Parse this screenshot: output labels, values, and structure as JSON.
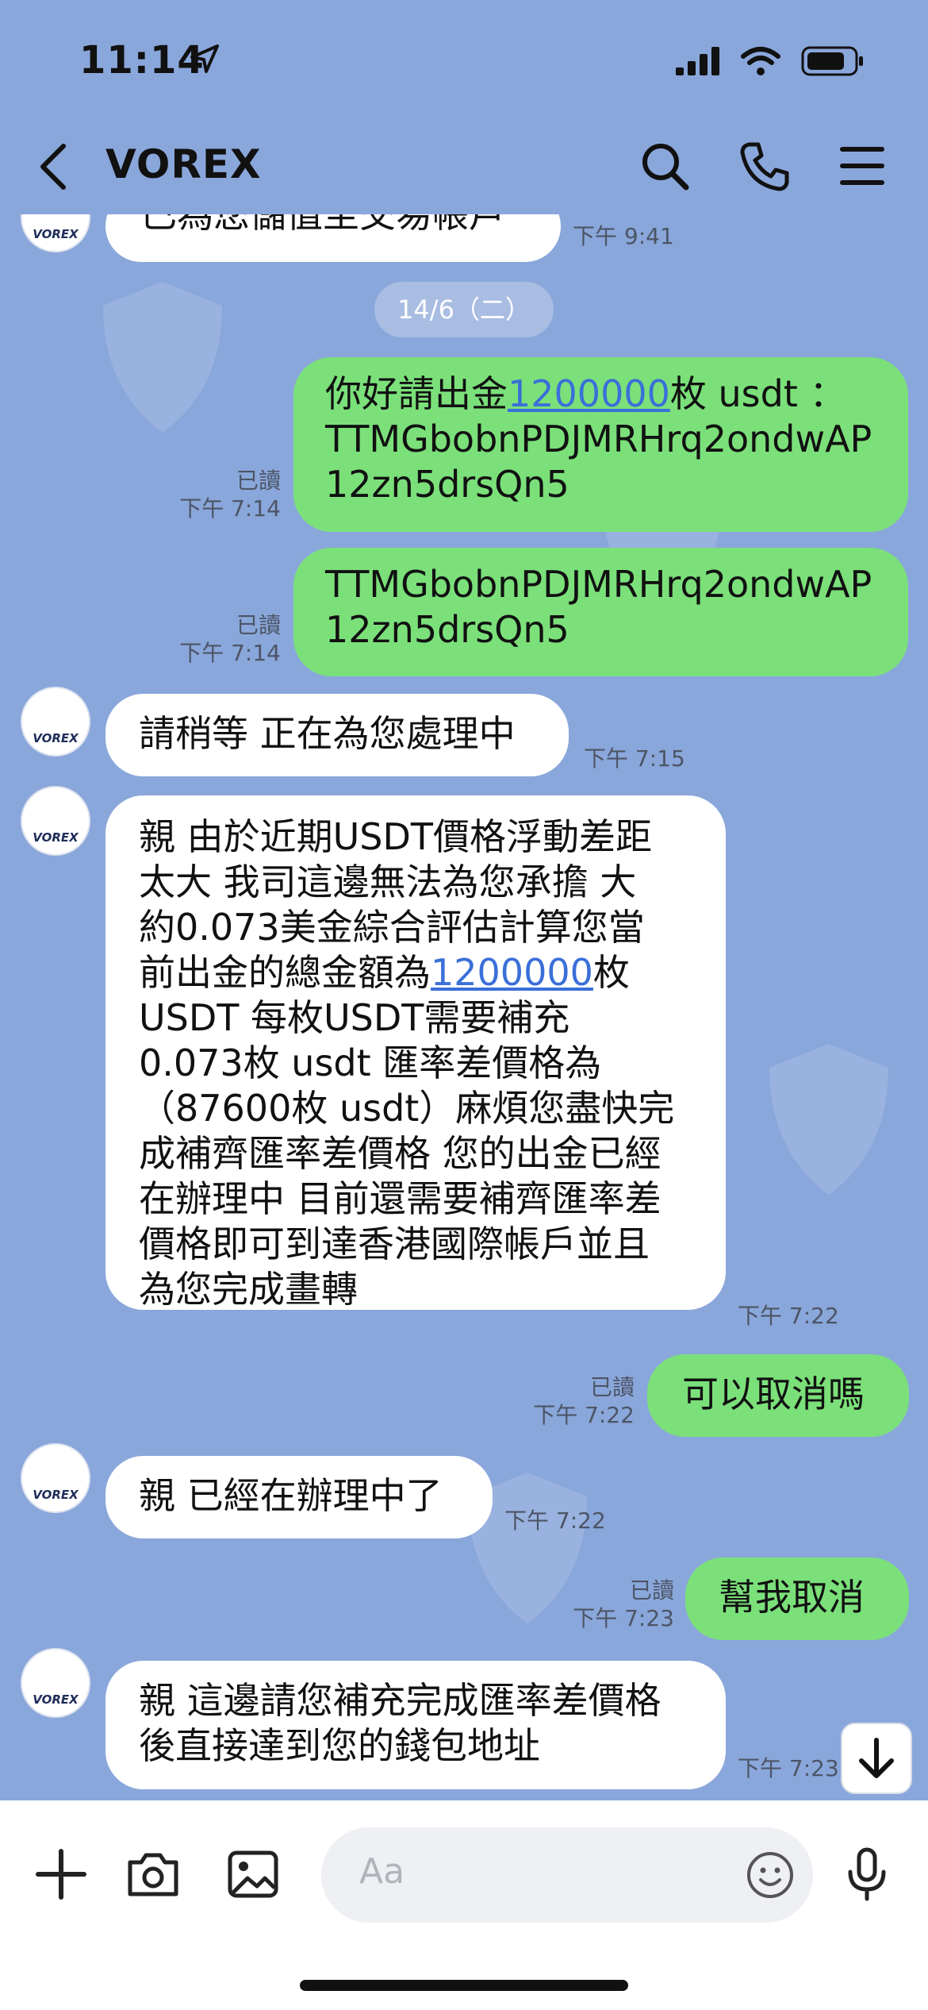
{
  "status_bar": {
    "time": "11:14"
  },
  "header": {
    "title": "VOREX"
  },
  "date_divider": "14/6（二）",
  "avatar_text": "VOREX",
  "messages": [
    {
      "text": "已為您儲值至交易帳戶",
      "time": "下午 9:41"
    },
    {
      "parts": [
        "你好請出金",
        "1200000",
        "枚 usdt ：\nTTMGbobnPDJMRHrq2ondwAP\n12zn5drsQn5"
      ],
      "read": "已讀",
      "time": "下午 7:14"
    },
    {
      "text": "TTMGbobnPDJMRHrq2ondwAP\n12zn5drsQn5",
      "read": "已讀",
      "time": "下午 7:14"
    },
    {
      "text": "請稍等 正在為您處理中",
      "time": "下午 7:15"
    },
    {
      "parts": [
        "親 由於近期USDT價格浮動差距\n太大 我司這邊無法為您承擔 大\n約0.073美金綜合評估計算您當\n前出金的總金額為",
        "1200000",
        "枚\nUSDT 每枚USDT需要補充\n0.073枚 usdt 匯率差價格為\n（87600枚 usdt）麻煩您盡快完\n成補齊匯率差價格 您的出金已經\n在辦理中 目前還需要補齊匯率差\n價格即可到達香港國際帳戶並且\n為您完成畫轉"
      ],
      "time": "下午 7:22"
    },
    {
      "text": "可以取消嗎",
      "read": "已讀",
      "time": "下午 7:22"
    },
    {
      "text": "親 已經在辦理中了",
      "time": "下午 7:22"
    },
    {
      "text": "幫我取消",
      "read": "已讀",
      "time": "下午 7:23"
    },
    {
      "text": "親 這邊請您補充完成匯率差價格\n後直接達到您的錢包地址",
      "time": "下午 7:23"
    }
  ],
  "composer": {
    "placeholder": "Aa"
  },
  "colors": {
    "chat_bg": "#8aa7db",
    "outgoing": "#7be07a",
    "incoming": "#ffffff",
    "link": "#3a6fd8"
  },
  "icons": [
    "location-arrow-icon",
    "signal-icon",
    "wifi-icon",
    "battery-icon",
    "back-icon",
    "search-icon",
    "phone-icon",
    "menu-icon",
    "plus-icon",
    "camera-icon",
    "image-icon",
    "emoji-icon",
    "microphone-icon",
    "arrow-down-icon"
  ]
}
